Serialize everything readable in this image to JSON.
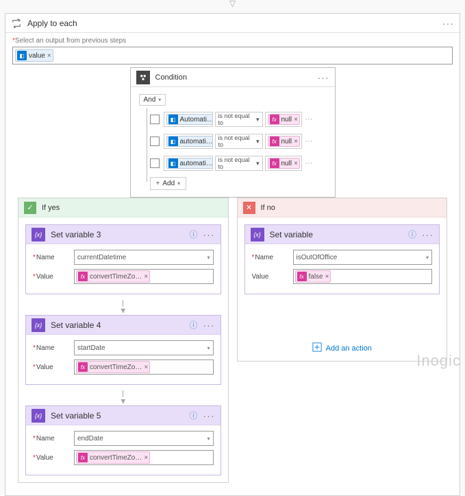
{
  "apply_each": {
    "title": "Apply to each",
    "prompt": "Select an output from previous steps",
    "token": {
      "label": "value"
    }
  },
  "condition": {
    "title": "Condition",
    "operator": "And",
    "rows": [
      {
        "left": "Automati…",
        "op": "is not equal to",
        "right": "null"
      },
      {
        "left": "automati…",
        "op": "is not equal to",
        "right": "null"
      },
      {
        "left": "automati…",
        "op": "is not equal to",
        "right": "null"
      }
    ],
    "add": "Add"
  },
  "branches": {
    "yes": {
      "title": "If yes"
    },
    "no": {
      "title": "If no"
    }
  },
  "actions_yes": [
    {
      "title": "Set variable 3",
      "name": "currentDatetime",
      "value_token": "convertTimeZo…"
    },
    {
      "title": "Set variable 4",
      "name": "startDate",
      "value_token": "convertTimeZo…"
    },
    {
      "title": "Set variable 5",
      "name": "endDate",
      "value_token": "convertTimeZo…"
    }
  ],
  "actions_no": [
    {
      "title": "Set variable",
      "name": "isOutOfOffice",
      "value_token": "false"
    }
  ],
  "labels": {
    "name": "Name",
    "value": "Value",
    "add_action": "Add an action"
  },
  "watermark": "Inogic"
}
